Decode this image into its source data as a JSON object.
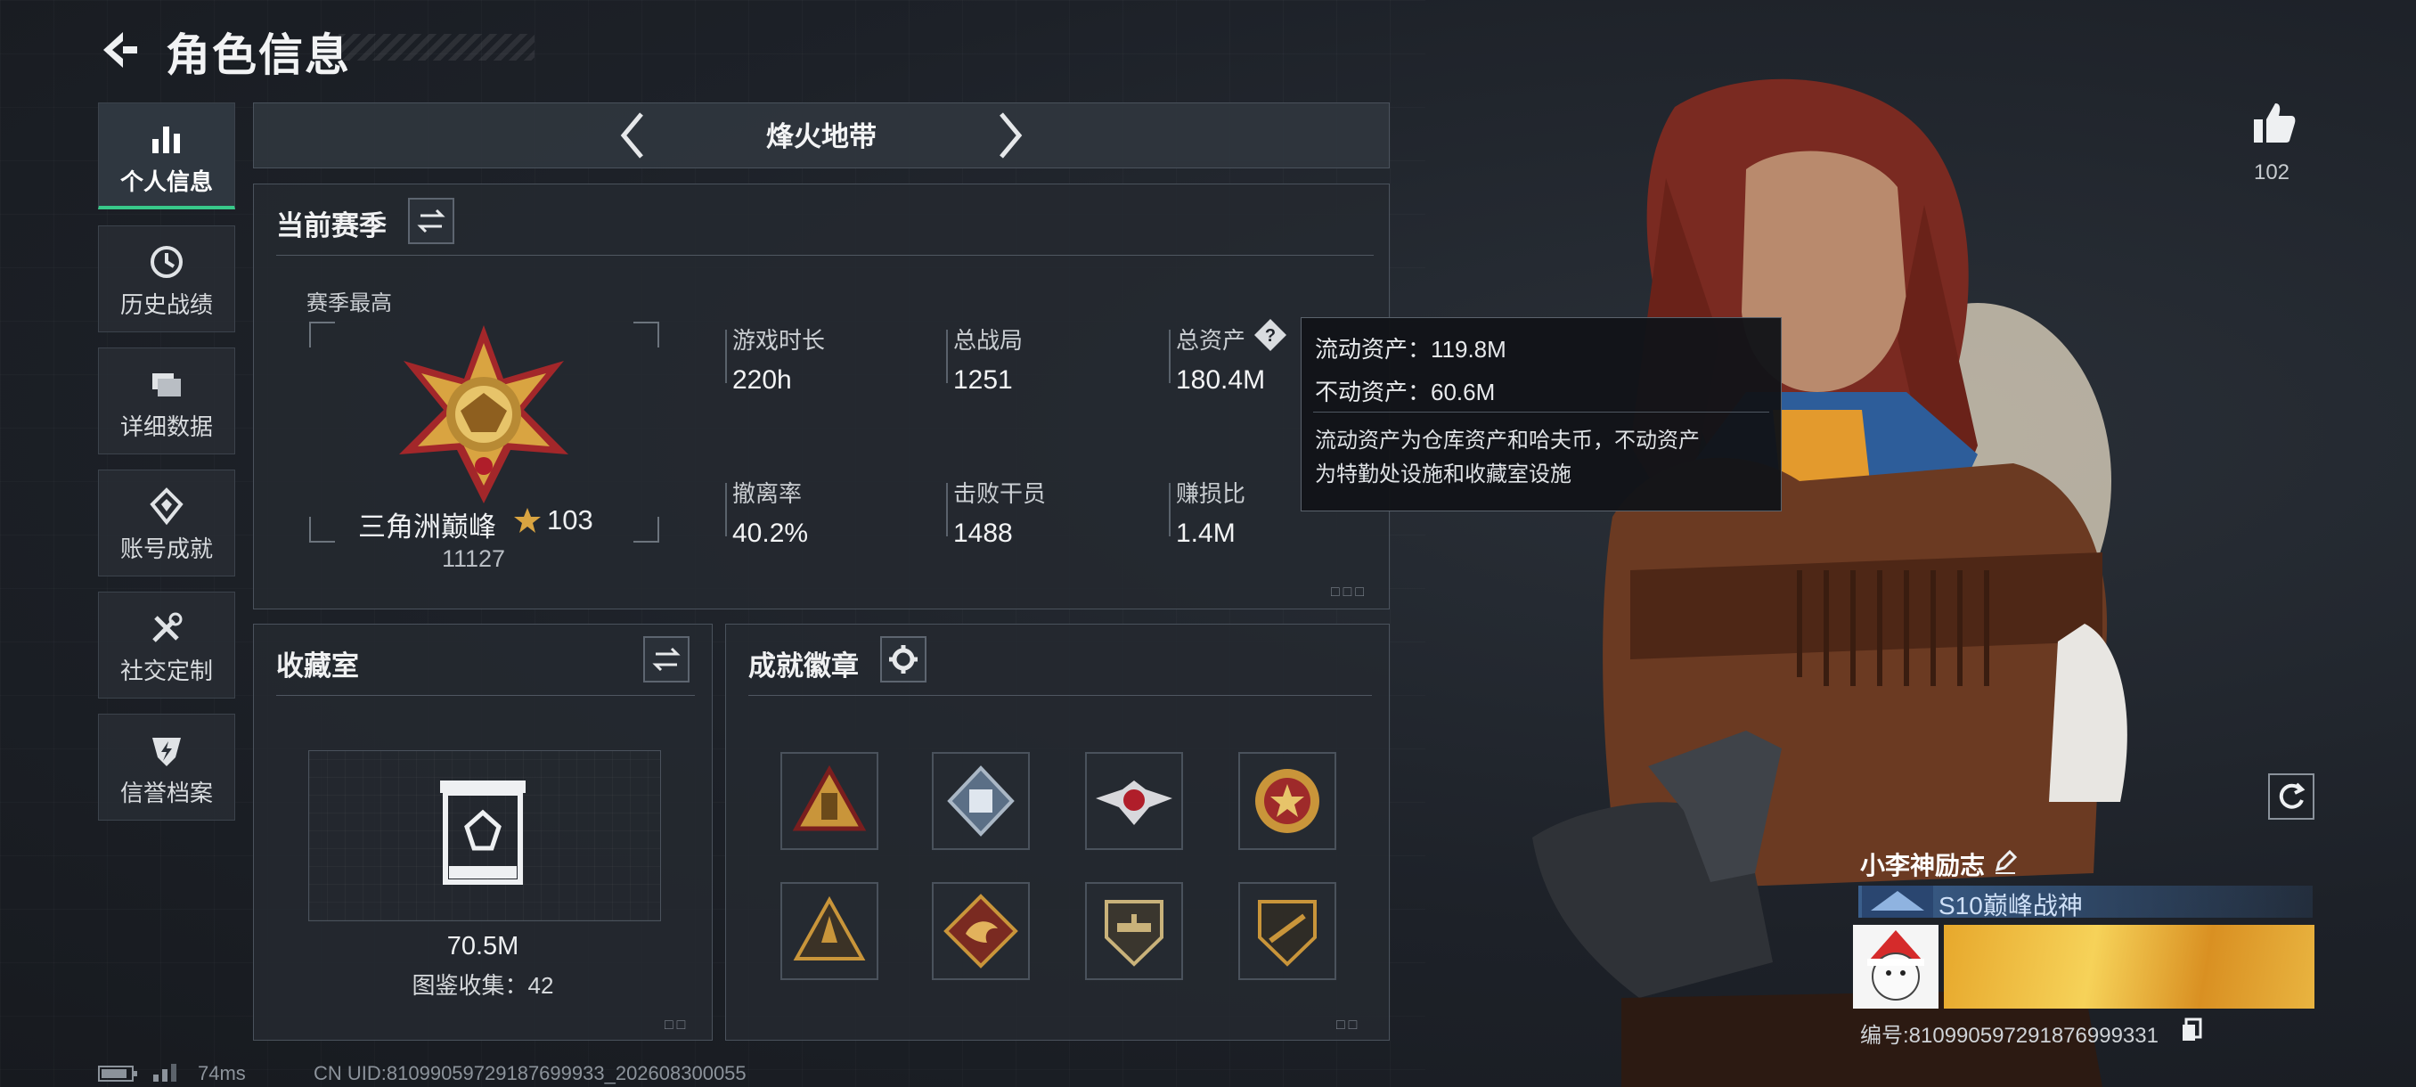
{
  "header": {
    "title": "角色信息"
  },
  "sidebar": {
    "items": [
      {
        "label": "个人信息",
        "icon": "bar-chart-icon",
        "active": true
      },
      {
        "label": "历史战绩",
        "icon": "clock-history-icon"
      },
      {
        "label": "详细数据",
        "icon": "folder-icon"
      },
      {
        "label": "账号成就",
        "icon": "diamond-badge-icon"
      },
      {
        "label": "社交定制",
        "icon": "tools-icon"
      },
      {
        "label": "信誉档案",
        "icon": "shield-bolt-icon"
      }
    ]
  },
  "mode": {
    "label": "烽火地带"
  },
  "season": {
    "title": "当前赛季",
    "best_label": "赛季最高",
    "rank_name": "三角洲巅峰",
    "rank_stars": "103",
    "rank_score": "11127",
    "stats": [
      {
        "label": "游戏时长",
        "value": "220h"
      },
      {
        "label": "总战局",
        "value": "1251"
      },
      {
        "label": "总资产",
        "value": "180.4M"
      },
      {
        "label": "撤离率",
        "value": "40.2%"
      },
      {
        "label": "击败干员",
        "value": "1488"
      },
      {
        "label": "赚损比",
        "value": "1.4M"
      }
    ]
  },
  "tooltip": {
    "liquid": "流动资产：119.8M",
    "fixed": "不动资产：60.6M",
    "desc1": "流动资产为仓库资产和哈夫币，不动资产",
    "desc2": "为特勤处设施和收藏室设施"
  },
  "collection": {
    "title": "收藏室",
    "value": "70.5M",
    "catalog": "图鉴收集：42"
  },
  "achievements": {
    "title": "成就徽章",
    "badges": [
      "triangle-badge-icon",
      "cube-badge-icon",
      "winged-skull-badge-icon",
      "star-medal-badge-icon",
      "rocket-triangle-badge-icon",
      "dragon-badge-icon",
      "helicopter-shield-badge-icon",
      "rifle-shield-badge-icon"
    ]
  },
  "profile": {
    "likes": "102",
    "player_name": "小李神励志",
    "title_badge": "S10巅峰战神",
    "id_line": "编号:810990597291876999331"
  },
  "footer": {
    "ping": "74ms",
    "uid": "CN UID:81099059729187699933_202608300055"
  },
  "colors": {
    "accent_green": "#38c98a",
    "gold": "#d9a441",
    "panel_border": "#4a525c"
  }
}
